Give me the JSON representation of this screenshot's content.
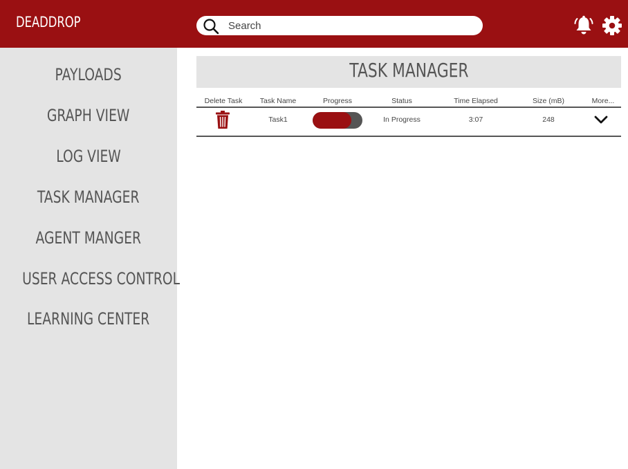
{
  "app": {
    "name": "DEADDROP",
    "accent_color": "#9a1012"
  },
  "header": {
    "search": {
      "placeholder": "Search",
      "value": "",
      "icon": "search-icon"
    },
    "notifications_icon": "bell-icon",
    "settings_icon": "gear-icon"
  },
  "sidebar": {
    "items": [
      {
        "label": "PAYLOADS"
      },
      {
        "label": "GRAPH VIEW"
      },
      {
        "label": "LOG VIEW"
      },
      {
        "label": "TASK MANAGER"
      },
      {
        "label": "AGENT MANGER"
      },
      {
        "label": "USER ACCESS CONTROL"
      },
      {
        "label": "LEARNING CENTER"
      }
    ]
  },
  "main": {
    "title": "TASK MANAGER",
    "table": {
      "columns": [
        "Delete Task",
        "Task Name",
        "Progress",
        "Status",
        "Time Elapsed",
        "Size (mB)",
        "More..."
      ],
      "rows": [
        {
          "delete_icon": "trash-icon",
          "task_name": "Task1",
          "progress_fraction": 0.78,
          "status": "In Progress",
          "time_elapsed": "3:07",
          "size_mb": "248",
          "more_icon": "chevron-down-icon"
        }
      ]
    }
  }
}
